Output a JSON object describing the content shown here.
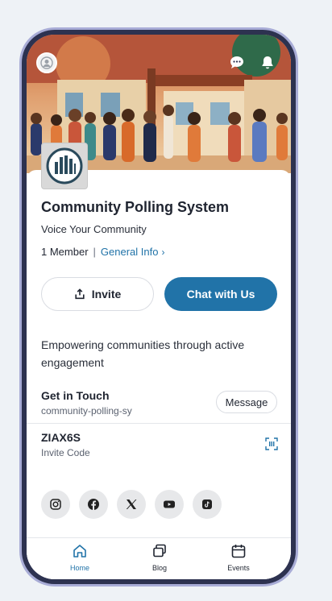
{
  "header": {
    "avatar_icon": "user-avatar-icon",
    "chat_icon": "chat-bubble-icon",
    "notification_icon": "bell-icon"
  },
  "community": {
    "name": "Community Polling System",
    "tagline": "Voice Your Community",
    "members": "1 Member",
    "info_link": "General Info",
    "logo_icon": "community-logo"
  },
  "actions": {
    "invite_label": "Invite",
    "chat_label": "Chat with Us"
  },
  "description": "Empowering communities through active engagement",
  "contact": {
    "title": "Get in Touch",
    "handle": "community-polling-sy",
    "message_label": "Message"
  },
  "invite": {
    "code": "ZIAX6S",
    "label": "Invite Code"
  },
  "socials": [
    "instagram-icon",
    "facebook-icon",
    "x-icon",
    "youtube-icon",
    "tiktok-icon"
  ],
  "nav": [
    {
      "label": "Home",
      "icon": "home-icon",
      "active": true
    },
    {
      "label": "Blog",
      "icon": "blog-icon",
      "active": false
    },
    {
      "label": "Events",
      "icon": "calendar-icon",
      "active": false
    }
  ],
  "colors": {
    "accent": "#2173a8",
    "frame": "#2d3250"
  }
}
